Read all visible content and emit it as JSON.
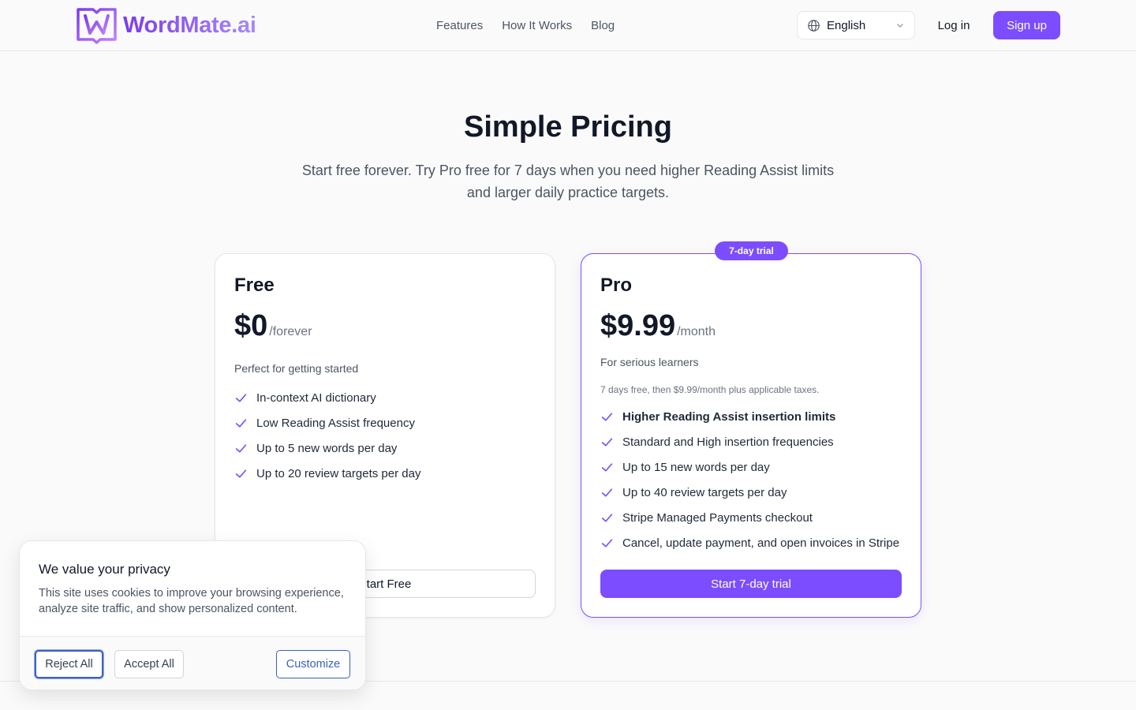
{
  "brand": {
    "name": "WordMate.ai",
    "accent": "#7c4dff"
  },
  "nav": {
    "items": [
      {
        "label": "Features"
      },
      {
        "label": "How It Works"
      },
      {
        "label": "Blog"
      }
    ]
  },
  "header": {
    "language": "English",
    "login_label": "Log in",
    "signup_label": "Sign up"
  },
  "hero": {
    "title": "Simple Pricing",
    "subtitle": "Start free forever. Try Pro free for 7 days when you need higher Reading Assist limits and larger daily practice targets."
  },
  "plans": {
    "free": {
      "name": "Free",
      "price": "$0",
      "period": "/forever",
      "description": "Perfect for getting started",
      "features": [
        "In-context AI dictionary",
        "Low Reading Assist frequency",
        "Up to 5 new words per day",
        "Up to 20 review targets per day"
      ],
      "cta": "Start Free"
    },
    "pro": {
      "badge": "7-day trial",
      "name": "Pro",
      "price": "$9.99",
      "period": "/month",
      "description": "For serious learners",
      "fine_print": "7 days free, then $9.99/month plus applicable taxes.",
      "features": [
        "Higher Reading Assist insertion limits",
        "Standard and High insertion frequencies",
        "Up to 15 new words per day",
        "Up to 40 review targets per day",
        "Stripe Managed Payments checkout",
        "Cancel, update payment, and open invoices in Stripe"
      ],
      "cta": "Start 7-day trial"
    }
  },
  "cookie_banner": {
    "title": "We value your privacy",
    "text": "This site uses cookies to improve your browsing experience, analyze site traffic, and show personalized content.",
    "reject_label": "Reject All",
    "accept_label": "Accept All",
    "customize_label": "Customize"
  }
}
